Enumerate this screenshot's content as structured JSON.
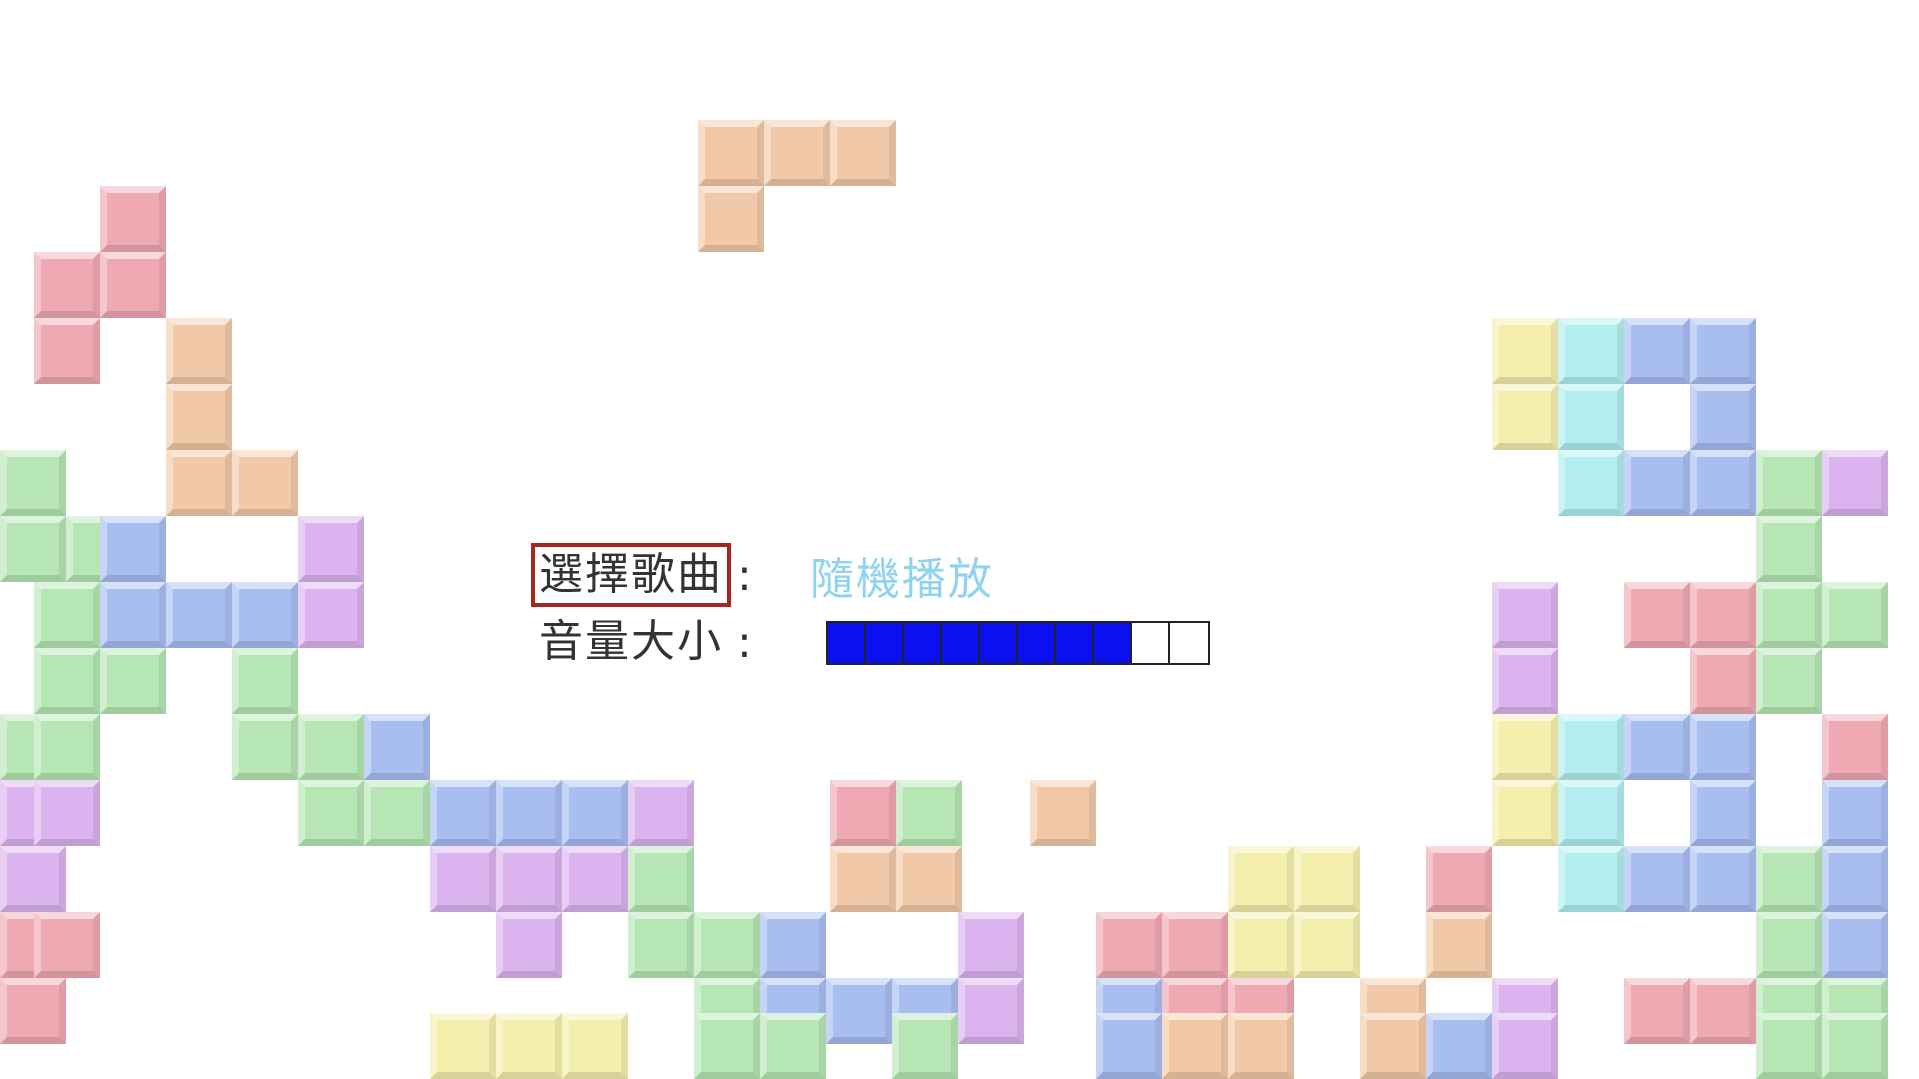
{
  "menu": {
    "song_label": "選擇歌曲",
    "song_colon": ":",
    "song_value": "隨機播放",
    "volume_label": "音量大小",
    "volume_colon": ":"
  },
  "volume": {
    "level": 8,
    "max": 10
  },
  "colors": {
    "selection_border": "#a8261f",
    "value_text": "#8fd3ef",
    "volume_fill": "#0a10f0",
    "block_orange": "#f2c9a8",
    "block_red": "#efa9b2",
    "block_green": "#b5e6b4",
    "block_blue": "#a8bdf0",
    "block_purple": "#dbb3ee",
    "block_cyan": "#b2eef0",
    "block_yellow": "#f5efae"
  }
}
